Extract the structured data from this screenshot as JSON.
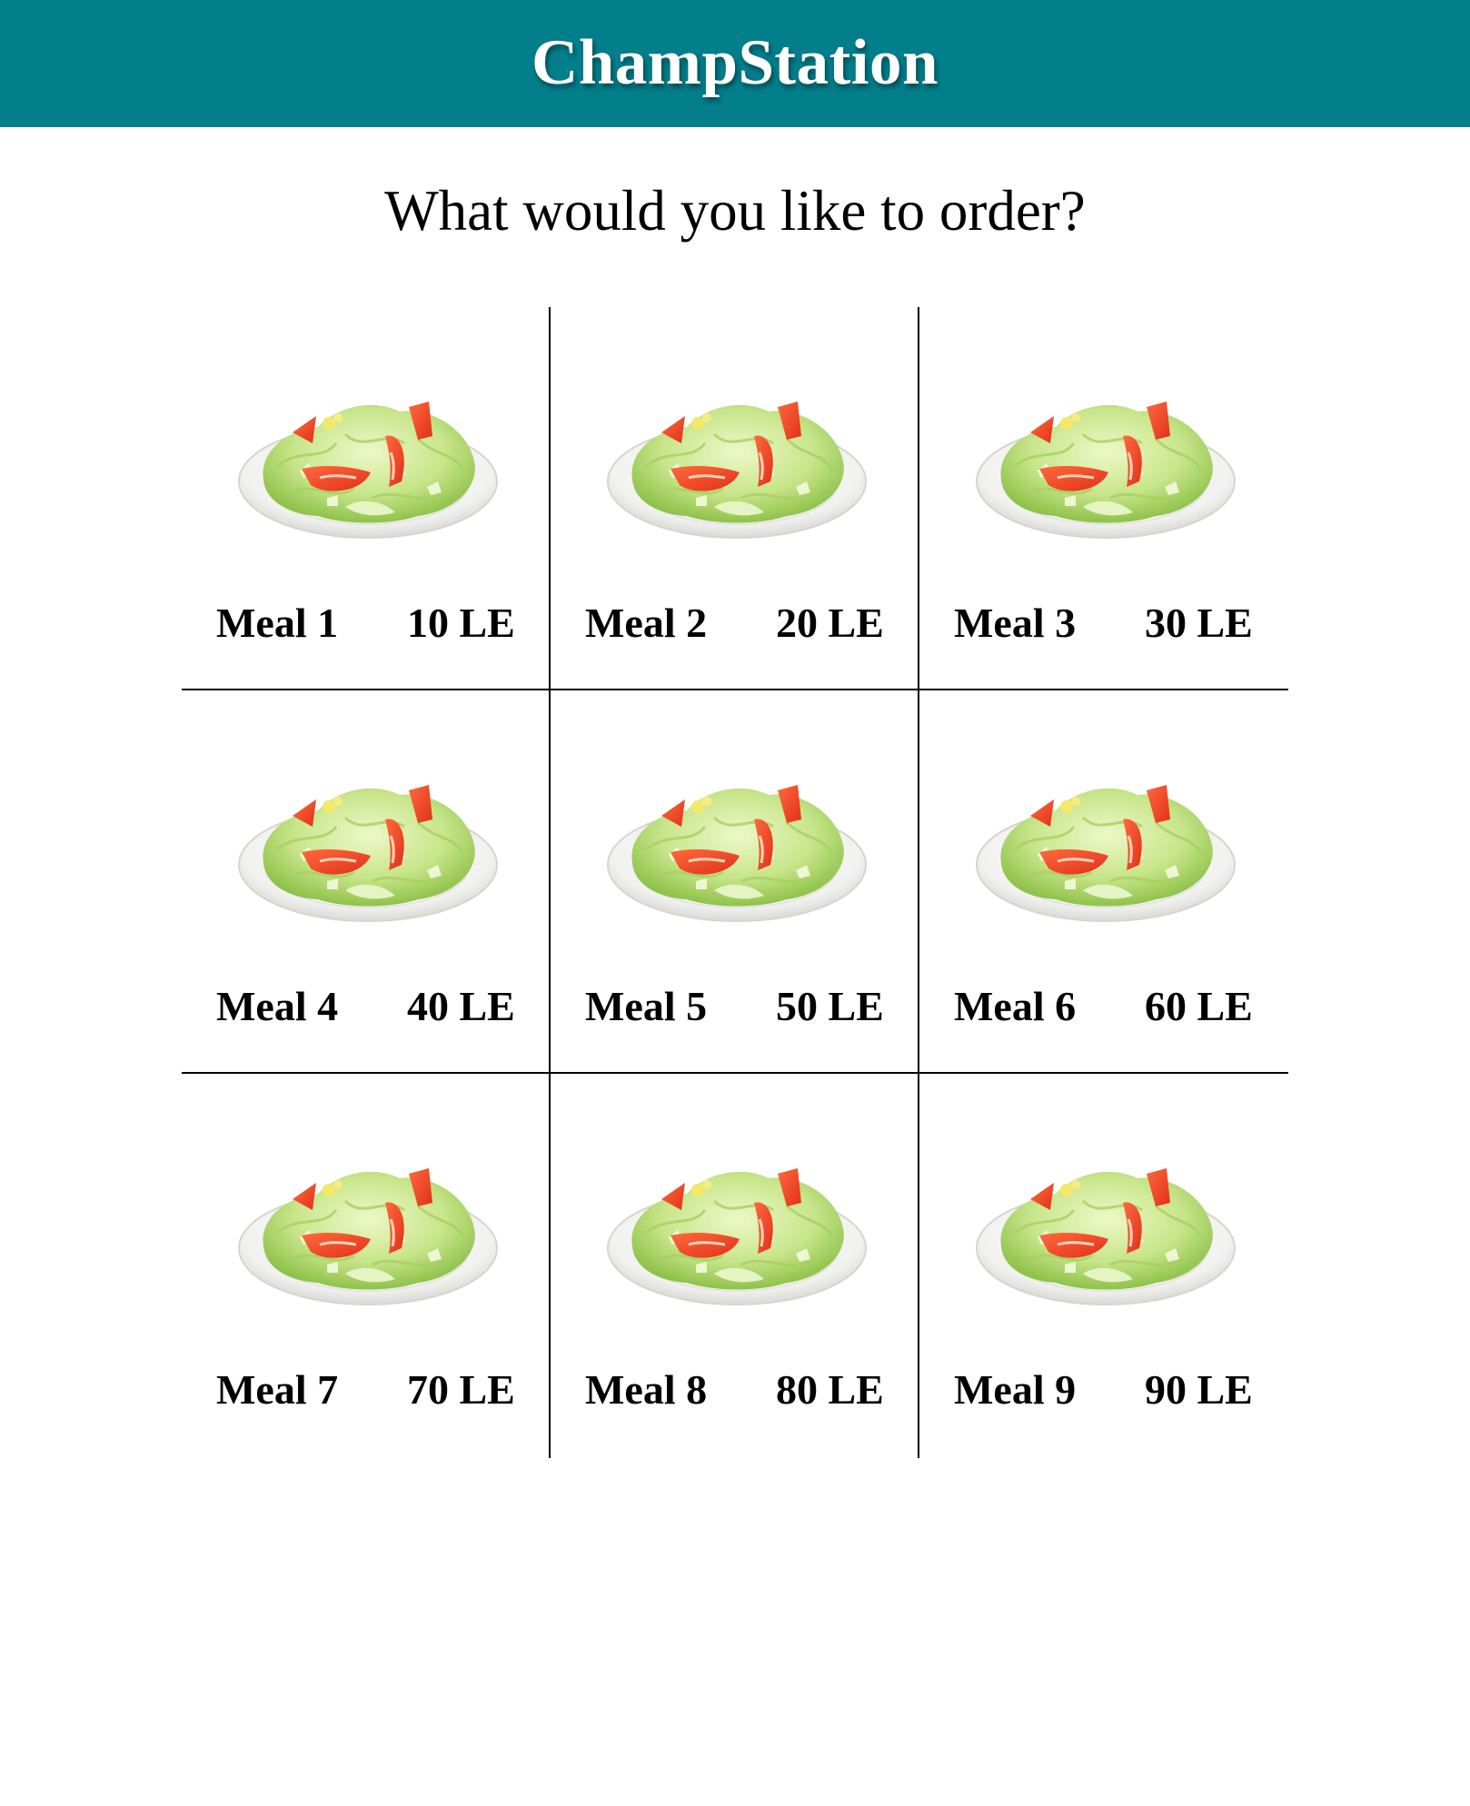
{
  "header": {
    "brand": "ChampStation",
    "background_color": "#037f8c"
  },
  "prompt": "What would you like to order?",
  "meals": [
    {
      "name": "Meal 1",
      "price": "10 LE",
      "image_icon": "salad-plate-image"
    },
    {
      "name": "Meal 2",
      "price": "20 LE",
      "image_icon": "salad-plate-image"
    },
    {
      "name": "Meal 3",
      "price": "30 LE",
      "image_icon": "salad-plate-image"
    },
    {
      "name": "Meal 4",
      "price": "40 LE",
      "image_icon": "salad-plate-image"
    },
    {
      "name": "Meal 5",
      "price": "50 LE",
      "image_icon": "salad-plate-image"
    },
    {
      "name": "Meal 6",
      "price": "60 LE",
      "image_icon": "salad-plate-image"
    },
    {
      "name": "Meal 7",
      "price": "70 LE",
      "image_icon": "salad-plate-image"
    },
    {
      "name": "Meal 8",
      "price": "80 LE",
      "image_icon": "salad-plate-image"
    },
    {
      "name": "Meal 9",
      "price": "90 LE",
      "image_icon": "salad-plate-image"
    }
  ]
}
